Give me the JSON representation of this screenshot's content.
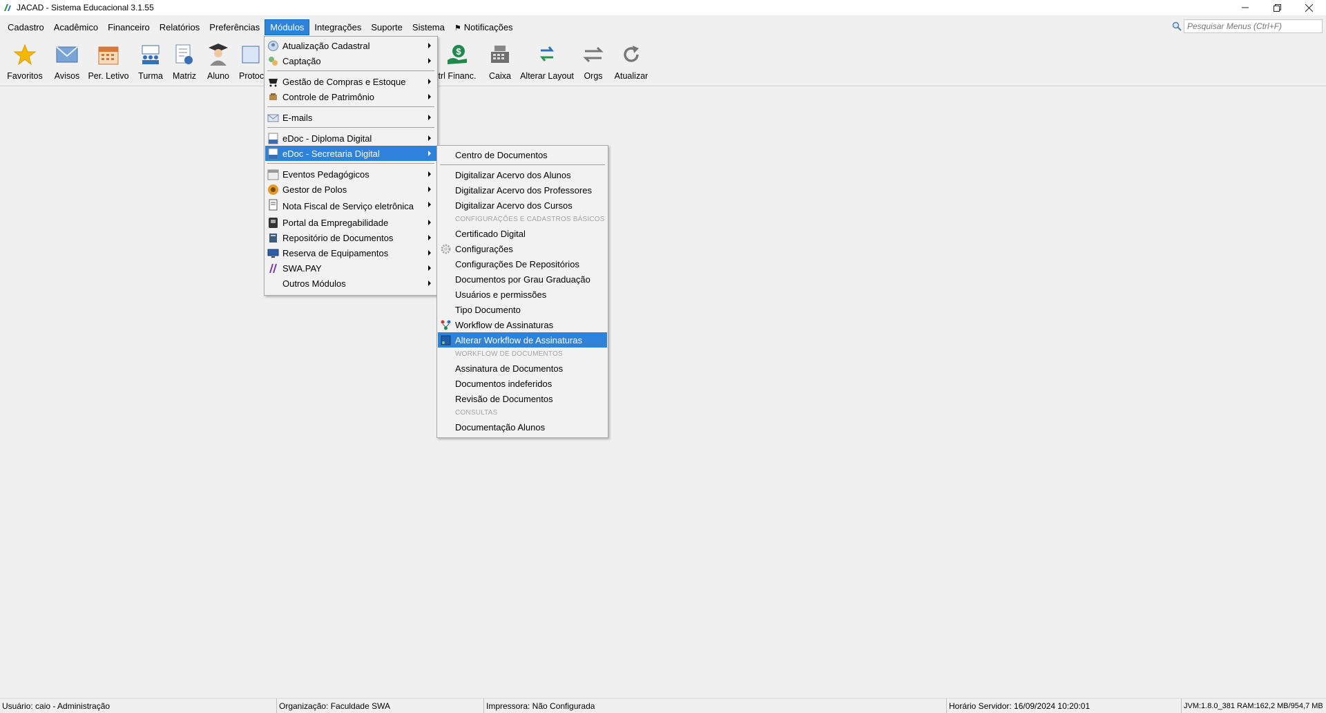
{
  "window": {
    "title": "JACAD - Sistema Educacional 3.1.55",
    "controls": [
      "minimize-icon",
      "restore-icon",
      "close-icon"
    ]
  },
  "menubar": {
    "items": [
      "Cadastro",
      "Acadêmico",
      "Financeiro",
      "Relatórios",
      "Preferências",
      "Módulos",
      "Integrações",
      "Suporte",
      "Sistema"
    ],
    "active": "Módulos",
    "notifications": "Notificações"
  },
  "search": {
    "placeholder": "Pesquisar Menus (Ctrl+F)"
  },
  "toolbar": {
    "items": [
      {
        "label": "Favoritos",
        "icon": "star-icon"
      },
      {
        "label": "Avisos",
        "icon": "envelope-icon"
      },
      {
        "label": "Per. Letivo",
        "icon": "calendar-icon"
      },
      {
        "label": "Turma",
        "icon": "class-group-icon"
      },
      {
        "label": "Matriz",
        "icon": "matrix-document-icon"
      },
      {
        "label": "Aluno",
        "icon": "graduate-student-icon"
      },
      {
        "label": "Protoc",
        "icon": "protocol-icon"
      },
      {
        "label": "trl Financ.",
        "icon": "money-hand-icon"
      },
      {
        "label": "Caixa",
        "icon": "cash-register-icon"
      },
      {
        "label": "Alterar Layout",
        "icon": "swap-layout-icon"
      },
      {
        "label": "Orgs",
        "icon": "exchange-arrows-icon"
      },
      {
        "label": "Atualizar",
        "icon": "refresh-icon"
      }
    ]
  },
  "modulos_menu": {
    "items": [
      {
        "label": "Atualização Cadastral",
        "icon": "profile-update-icon"
      },
      {
        "label": "Captação",
        "icon": "capture-icon"
      },
      {
        "label": "Gestão de Compras e Estoque",
        "icon": "purchase-icon"
      },
      {
        "label": "Controle de Patrimônio",
        "icon": "asset-icon"
      },
      {
        "label": "E-mails",
        "icon": "email-icon"
      },
      {
        "label": "eDoc - Diploma Digital",
        "icon": "edoc-icon"
      },
      {
        "label": "eDoc - Secretaria Digital",
        "icon": "edoc-icon"
      },
      {
        "label": "Eventos Pedagógicos",
        "icon": "calendar-events-icon"
      },
      {
        "label": "Gestor de Polos",
        "icon": "poles-icon"
      },
      {
        "label": "Nota Fiscal de Serviço eletrônica",
        "icon": "invoice-icon"
      },
      {
        "label": "Portal da Empregabilidade",
        "icon": "portal-icon"
      },
      {
        "label": "Repositório de Documentos",
        "icon": "repository-icon"
      },
      {
        "label": "Reserva de Equipamentos",
        "icon": "monitor-icon"
      },
      {
        "label": "SWA.PAY",
        "icon": "swapay-icon"
      },
      {
        "label": "Outros Módulos",
        "icon": ""
      }
    ],
    "highlighted": "eDoc - Secretaria Digital"
  },
  "submenu": {
    "items": [
      {
        "label": "Centro de Documentos"
      },
      {
        "label": "Digitalizar Acervo dos Alunos"
      },
      {
        "label": "Digitalizar Acervo dos Professores"
      },
      {
        "label": "Digitalizar Acervo dos Cursos"
      },
      {
        "label": "Certificado Digital"
      },
      {
        "label": "Configurações",
        "icon": "gear-icon"
      },
      {
        "label": "Configurações De Repositórios"
      },
      {
        "label": "Documentos por Grau Graduação"
      },
      {
        "label": "Usuários e permissões"
      },
      {
        "label": "Tipo Documento"
      },
      {
        "label": "Workflow de Assinaturas",
        "icon": "workflow-icon"
      },
      {
        "label": "Alterar Workflow de Assinaturas",
        "icon": "workflow-edit-icon"
      },
      {
        "label": "Assinatura de Documentos"
      },
      {
        "label": "Documentos indeferidos"
      },
      {
        "label": "Revisão de Documentos"
      },
      {
        "label": "Documentação Alunos"
      }
    ],
    "headers": [
      "CONFIGURAÇÕES E CADASTROS BÁSICOS",
      "WORKFLOW DE DOCUMENTOS",
      "CONSULTAS"
    ],
    "highlighted": "Alterar Workflow de Assinaturas"
  },
  "statusbar": {
    "user": "Usuário: caio - Administração",
    "organization": "Organização: Faculdade SWA",
    "printer": "Impressora: Não Configurada",
    "server_time": "Horário Servidor: 16/09/2024 10:20:01",
    "jvm": "JVM:1.8.0_381  RAM:162,2 MB/954,7 MB"
  },
  "colors": {
    "highlight": "#2e82d9",
    "background": "#f0f0f0",
    "menu_bg": "#f2f2f2"
  }
}
